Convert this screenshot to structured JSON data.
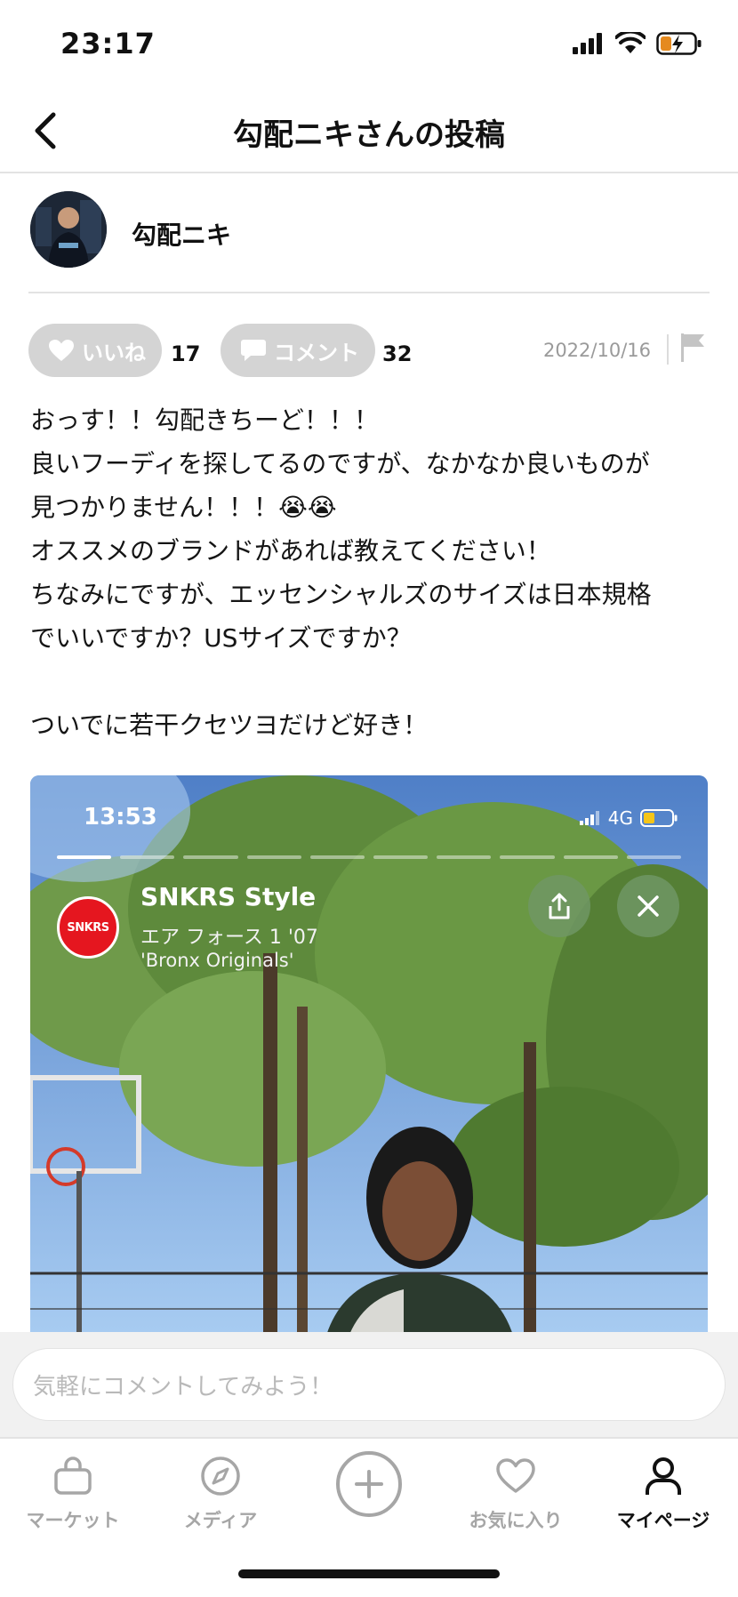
{
  "status_bar": {
    "time": "23:17"
  },
  "header": {
    "title": "勾配ニキさんの投稿"
  },
  "author": {
    "name": "勾配ニキ"
  },
  "actions": {
    "like_label": "いいね",
    "like_count": "17",
    "comment_label": "コメント",
    "comment_count": "32",
    "date": "2022/10/16"
  },
  "post": {
    "body": "おっす！！勾配きちーど！！！\n良いフーディを探してるのですが、なかなか良いものが\n見つかりません！！！😭😭\nオススメのブランドがあれば教えてください！\nちなみにですが、エッセンシャルズのサイズは日本規格\nでいいですか？USサイズですか？\n\nついでに若干クセツヨだけど好き！"
  },
  "media": {
    "time": "13:53",
    "network": "4G",
    "story_segments": 10,
    "story_segments_done": 1,
    "logo_text": "SNKRS",
    "title": "SNKRS Style",
    "product_line1": "エア フォース 1 '07",
    "product_line2": "'Bronx Originals'"
  },
  "comment_bar": {
    "placeholder": "気軽にコメントしてみよう！"
  },
  "tab_bar": {
    "market": "マーケット",
    "media": "メディア",
    "favorites": "お気に入り",
    "mypage": "マイページ",
    "active": "mypage"
  },
  "colors": {
    "pill_bg": "#d4d4d4",
    "snkrs_red": "#e5161f",
    "inactive_tab": "#a6a6a6",
    "battery_yellow": "#f5c518",
    "battery_charging": "#e58a1f"
  },
  "icons": {
    "back": "chevron-left-icon",
    "like": "heart-icon",
    "comment": "speech-bubble-icon",
    "report": "flag-icon",
    "share": "share-icon",
    "close": "close-icon",
    "market": "shopping-bag-icon",
    "media": "compass-icon",
    "post": "plus-circle-icon",
    "favorites": "heart-outline-icon",
    "mypage": "person-icon"
  }
}
